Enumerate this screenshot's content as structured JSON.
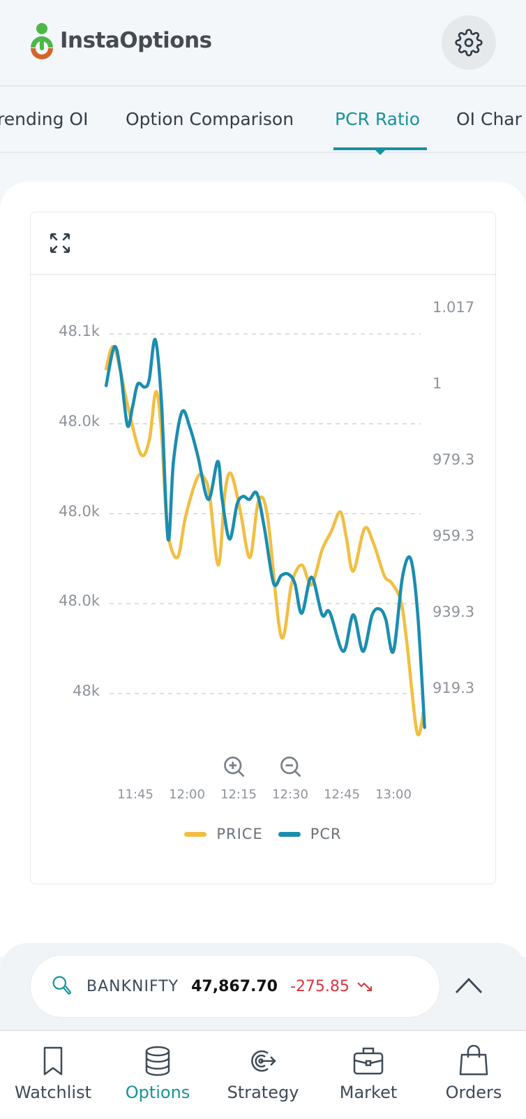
{
  "app": {
    "title": "InstaOptions"
  },
  "tabs": [
    {
      "label": "rending OI"
    },
    {
      "label": "Option Comparison"
    },
    {
      "label": "PCR Ratio",
      "active": true
    },
    {
      "label": "OI Char"
    }
  ],
  "colors": {
    "accent": "#17929b",
    "price": "#F2BE42",
    "pcr": "#1A8DB0",
    "negative": "#d9363e"
  },
  "icons": {
    "header": "gear-icon",
    "chart_toolbar": "expand-icon",
    "zoom": [
      "zoom-in-icon",
      "zoom-out-icon"
    ]
  },
  "chart_data": {
    "type": "line",
    "title": "",
    "grid": true,
    "legend_position": "bottom",
    "x_ticks": [
      "11:45",
      "12:00",
      "12:15",
      "12:30",
      "12:45",
      "13:00"
    ],
    "y_left": {
      "ticks": [
        48100,
        48050,
        48000,
        47950,
        47900
      ],
      "tick_labels": [
        "48.1k",
        "48.0k",
        "48.0k",
        "48.0k",
        "48k"
      ]
    },
    "y_right": {
      "ticks": [
        1019.3,
        999.3,
        979.3,
        959.3,
        939.3,
        919.3
      ],
      "tick_labels": [
        "1.017",
        "1",
        "979.3",
        "959.3",
        "939.3",
        "919.3"
      ]
    },
    "series": [
      {
        "name": "PRICE",
        "axis": "left",
        "points": [
          [
            "11:36:31",
            48080.6
          ],
          [
            "11:38:54",
            48092.4
          ],
          [
            "11:42:52",
            48059.4
          ],
          [
            "11:46:34",
            48033.2
          ],
          [
            "11:49:02",
            48040.8
          ],
          [
            "11:50:58",
            48067.9
          ],
          [
            "11:52:34",
            48045.9
          ],
          [
            "11:54:19",
            47991.8
          ],
          [
            "11:57:14",
            47975.7
          ],
          [
            "11:59:37",
            47998.6
          ],
          [
            "12:03:08",
            48020.5
          ],
          [
            "12:05:20",
            48018.9
          ],
          [
            "12:06:40",
            48008.7
          ],
          [
            "12:09:08",
            47971.5
          ],
          [
            "12:11:04",
            48012.1
          ],
          [
            "12:12:50",
            48022.2
          ],
          [
            "12:15:28",
            48001.9
          ],
          [
            "12:18:17",
            47975.7
          ],
          [
            "12:20:46",
            48007.0
          ],
          [
            "12:23:24",
            47998.6
          ],
          [
            "12:27:22",
            47931.8
          ],
          [
            "12:30:27",
            47961.4
          ],
          [
            "12:33:22",
            47971.5
          ],
          [
            "12:36:11",
            47960.5
          ],
          [
            "12:39:16",
            47980.0
          ],
          [
            "12:41:55",
            47990.1
          ],
          [
            "12:44:33",
            48001.1
          ],
          [
            "12:46:19",
            47986.7
          ],
          [
            "12:48:20",
            47968.1
          ],
          [
            "12:51:36",
            47991.8
          ],
          [
            "12:54:15",
            47983.3
          ],
          [
            "12:57:20",
            47965.6
          ],
          [
            "12:59:32",
            47961.4
          ],
          [
            "13:02:11",
            47951.2
          ],
          [
            "13:03:56",
            47927.6
          ],
          [
            "13:06:51",
            47878.5
          ],
          [
            "13:08:47",
            47890.4
          ]
        ]
      },
      {
        "name": "PCR",
        "axis": "right",
        "points": [
          [
            "11:36:31",
            999.1
          ],
          [
            "11:38:54",
            1009.3
          ],
          [
            "11:40:40",
            1003.1
          ],
          [
            "11:42:41",
            988.7
          ],
          [
            "11:44:11",
            993.5
          ],
          [
            "11:45:41",
            999.5
          ],
          [
            "11:47:43",
            998.7
          ],
          [
            "11:49:02",
            1000.7
          ],
          [
            "11:50:47",
            1011.2
          ],
          [
            "11:52:34",
            995.1
          ],
          [
            "11:54:30",
            958.8
          ],
          [
            "11:56:05",
            979.2
          ],
          [
            "11:58:33",
            992.2
          ],
          [
            "12:00:56",
            987.9
          ],
          [
            "12:03:08",
            980.7
          ],
          [
            "12:06:13",
            969.2
          ],
          [
            "12:08:57",
            979.2
          ],
          [
            "12:10:11",
            969.6
          ],
          [
            "12:12:23",
            958.8
          ],
          [
            "12:14:35",
            968.0
          ],
          [
            "12:16:21",
            970.0
          ],
          [
            "12:18:07",
            969.2
          ],
          [
            "12:20:19",
            970.8
          ],
          [
            "12:22:31",
            961.6
          ],
          [
            "12:25:10",
            947.2
          ],
          [
            "12:27:22",
            949.2
          ],
          [
            "12:29:24",
            949.6
          ],
          [
            "12:31:20",
            947.2
          ],
          [
            "12:33:22",
            939.3
          ],
          [
            "12:36:11",
            948.8
          ],
          [
            "12:39:16",
            938.9
          ],
          [
            "12:41:28",
            939.6
          ],
          [
            "12:45:26",
            929.3
          ],
          [
            "12:48:20",
            938.9
          ],
          [
            "12:51:10",
            929.3
          ],
          [
            "12:53:49",
            938.9
          ],
          [
            "12:56:01",
            940.4
          ],
          [
            "12:57:46",
            937.7
          ],
          [
            "12:59:59",
            929.3
          ],
          [
            "13:02:37",
            948.8
          ],
          [
            "13:05:00",
            953.6
          ],
          [
            "13:07:02",
            939.3
          ],
          [
            "13:09:03",
            909.3
          ]
        ]
      }
    ]
  },
  "ticker": {
    "symbol": "BANKNIFTY",
    "price": "47,867.70",
    "change": "-275.85",
    "trend": "down"
  },
  "nav": [
    {
      "label": "Watchlist"
    },
    {
      "label": "Options",
      "active": true
    },
    {
      "label": "Strategy"
    },
    {
      "label": "Market"
    },
    {
      "label": "Orders"
    }
  ]
}
